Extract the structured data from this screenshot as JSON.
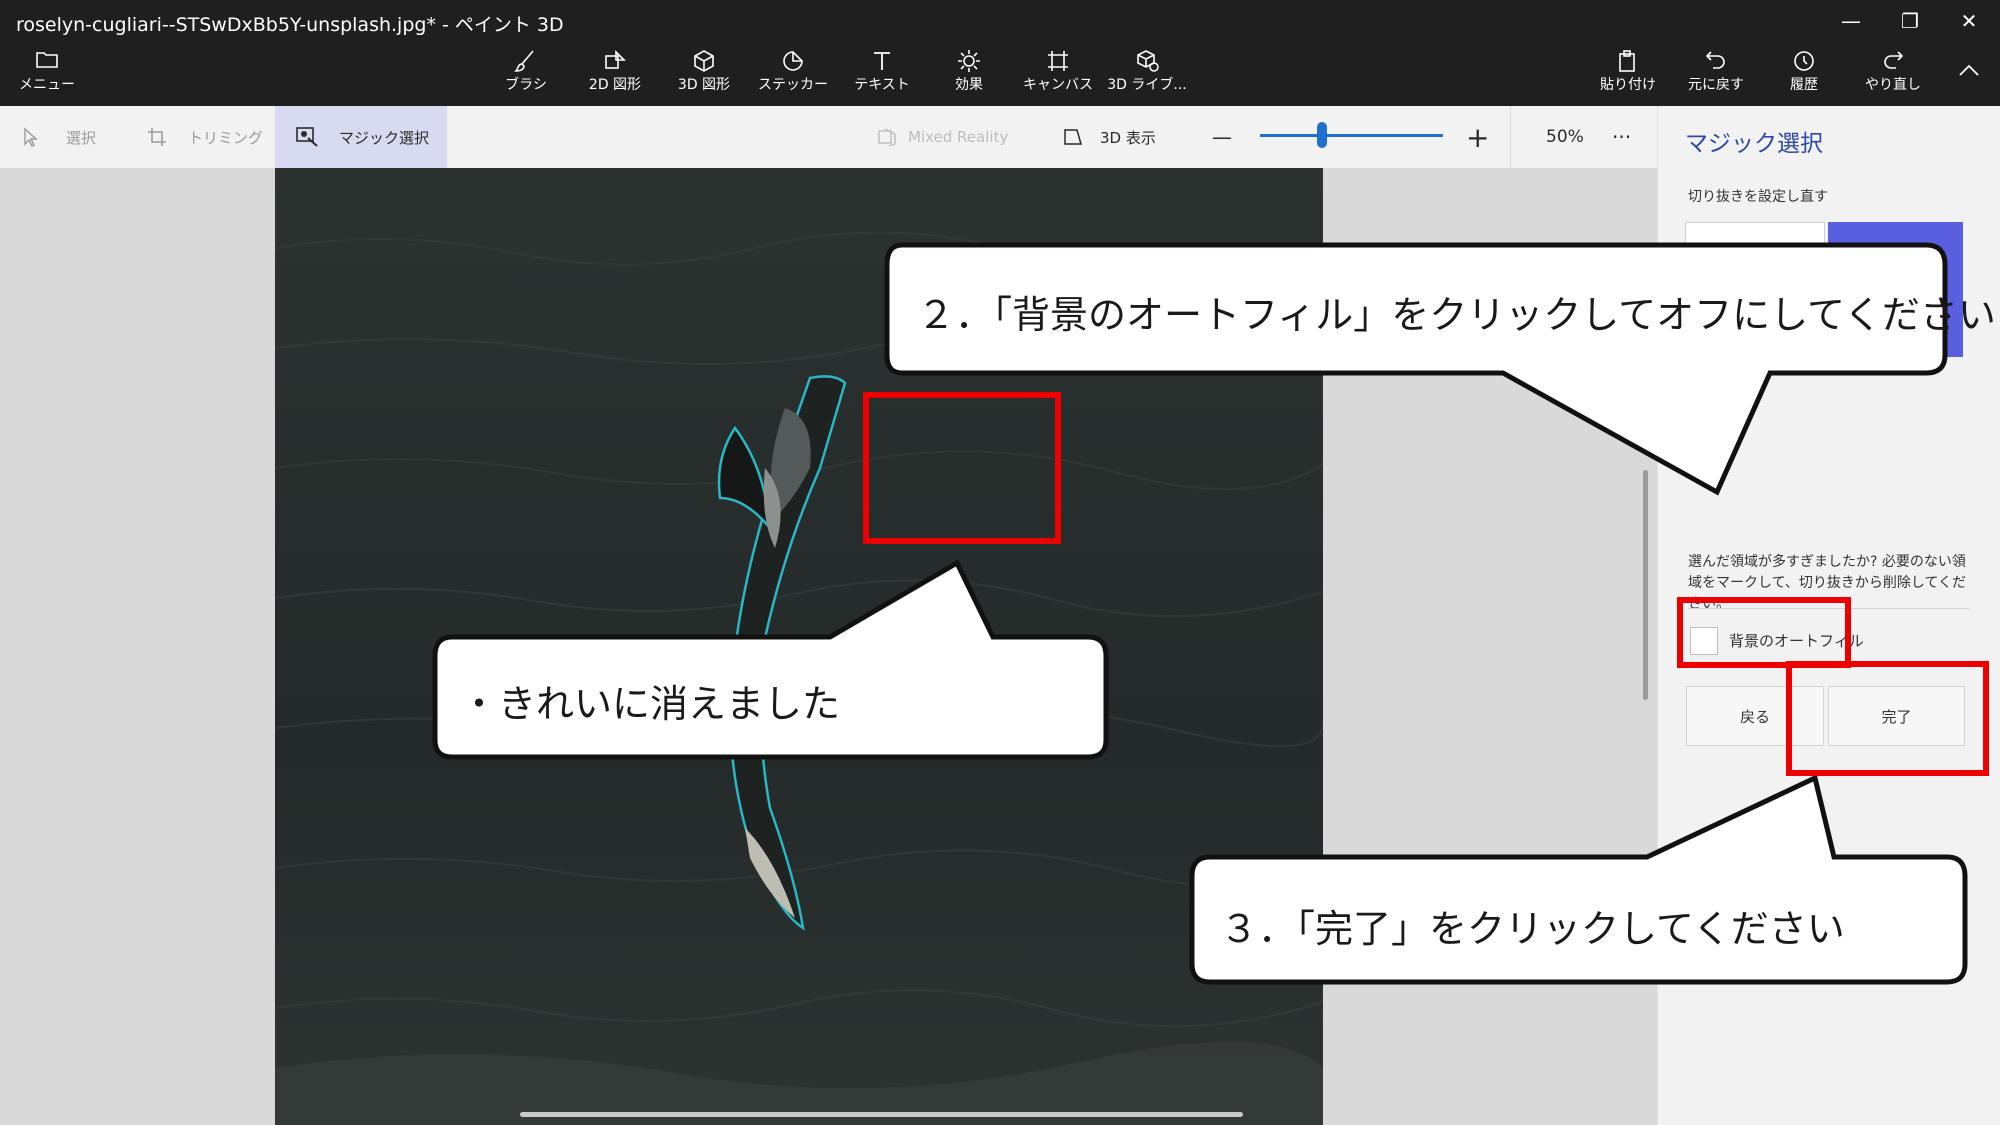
{
  "window": {
    "title": "roselyn-cugliari--STSwDxBb5Y-unsplash.jpg* - ペイント 3D",
    "minimize_glyph": "—",
    "maximize_glyph": "❐",
    "close_glyph": "✕"
  },
  "ribbon": {
    "menu_label": "メニュー",
    "tools": [
      {
        "label": "ブラシ",
        "icon": "brush-icon"
      },
      {
        "label": "2D 図形",
        "icon": "shapes-2d-icon"
      },
      {
        "label": "3D 図形",
        "icon": "cube-icon"
      },
      {
        "label": "ステッカー",
        "icon": "sticker-icon"
      },
      {
        "label": "テキスト",
        "icon": "text-icon"
      },
      {
        "label": "効果",
        "icon": "sun-icon"
      },
      {
        "label": "キャンバス",
        "icon": "canvas-icon"
      },
      {
        "label": "3D ライブ...",
        "icon": "library-icon"
      }
    ],
    "right_tools": [
      {
        "label": "貼り付け",
        "icon": "paste-icon"
      },
      {
        "label": "元に戻す",
        "icon": "undo-icon"
      },
      {
        "label": "履歴",
        "icon": "history-icon"
      },
      {
        "label": "やり直し",
        "icon": "redo-icon"
      }
    ]
  },
  "toolbar2": {
    "select": "選択",
    "crop": "トリミング",
    "magic_select": "マジック選択",
    "mixed_reality": "Mixed Reality",
    "view3d": "3D 表示",
    "zoom_minus": "—",
    "zoom_plus": "+",
    "zoom_value": 0.34,
    "zoom_text": "50%",
    "more": "···"
  },
  "panel": {
    "title": "マジック選択",
    "reset_label": "切り抜きを設定し直す",
    "help_text": "選んだ領域が多すぎましたか? 必要のない領域をマークして、切り抜きから削除してください。",
    "bg_autofill_label": "背景のオートフィル",
    "bg_autofill_checked": false,
    "back_button": "戻る",
    "done_button": "完了",
    "accent": "#5a5fe0"
  },
  "annotations": {
    "callout_step2": "２．「背景のオートフィル」をクリックしてオフにしてください",
    "callout_note": "・きれいに消えました",
    "callout_step3": "３．「完了」をクリックしてください",
    "highlight_color": "#ee0000"
  }
}
